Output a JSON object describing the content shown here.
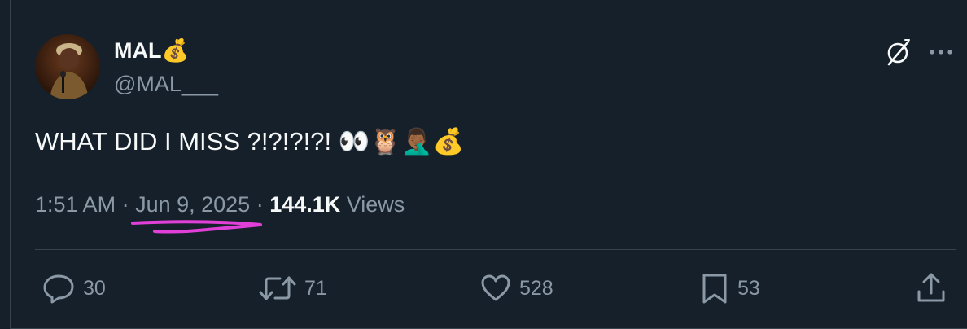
{
  "author": {
    "display_name": "MAL💰",
    "handle": "@MAL___"
  },
  "tweet": {
    "text": "WHAT DID I MISS ?!?!?!?! 👀🦉🤦🏾‍♂️💰"
  },
  "meta": {
    "time": "1:51 AM",
    "separator": " · ",
    "date": "Jun 9, 2025",
    "views_count": "144.1K",
    "views_label": " Views"
  },
  "actions": {
    "replies": "30",
    "retweets": "71",
    "likes": "528",
    "bookmarks": "53"
  },
  "icons": {
    "grok": "grok-icon",
    "more": "more-icon",
    "reply": "reply-icon",
    "retweet": "retweet-icon",
    "like": "heart-icon",
    "bookmark": "bookmark-icon",
    "share": "share-icon"
  },
  "colors": {
    "background": "#15202b",
    "text_primary": "#f7f9f9",
    "text_secondary": "#8b98a5",
    "divider": "#38444d",
    "annotation": "#e040d8"
  }
}
